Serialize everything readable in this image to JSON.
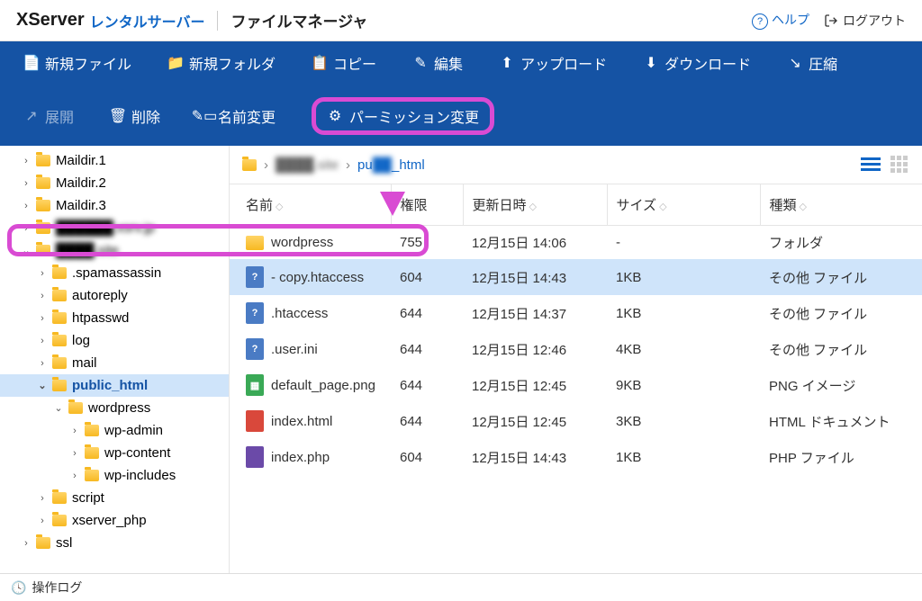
{
  "header": {
    "logo": "XServer",
    "logo_sub": "レンタルサーバー",
    "app_title": "ファイルマネージャ",
    "help": "ヘルプ",
    "logout": "ログアウト"
  },
  "toolbar": {
    "new_file": "新規ファイル",
    "new_folder": "新規フォルダ",
    "copy": "コピー",
    "edit": "編集",
    "upload": "アップロード",
    "download": "ダウンロード",
    "compress": "圧縮",
    "expand": "展開",
    "delete": "削除",
    "rename": "名前変更",
    "permission": "パーミッション変更"
  },
  "tree": [
    {
      "indent": 1,
      "chev": ">",
      "label": "Maildir.1"
    },
    {
      "indent": 1,
      "chev": ">",
      "label": "Maildir.2"
    },
    {
      "indent": 1,
      "chev": ">",
      "label": "Maildir.3"
    },
    {
      "indent": 1,
      "chev": ">",
      "label": "██████.xsrv.jp",
      "blur": true
    },
    {
      "indent": 1,
      "chev": "v",
      "label": "████.site",
      "blur": true
    },
    {
      "indent": 2,
      "chev": ">",
      "label": ".spamassassin"
    },
    {
      "indent": 2,
      "chev": ">",
      "label": "autoreply"
    },
    {
      "indent": 2,
      "chev": ">",
      "label": "htpasswd"
    },
    {
      "indent": 2,
      "chev": ">",
      "label": "log"
    },
    {
      "indent": 2,
      "chev": ">",
      "label": "mail"
    },
    {
      "indent": 2,
      "chev": "v",
      "label": "public_html",
      "selected": true
    },
    {
      "indent": 3,
      "chev": "v",
      "label": "wordpress"
    },
    {
      "indent": 4,
      "chev": ">",
      "label": "wp-admin"
    },
    {
      "indent": 4,
      "chev": ">",
      "label": "wp-content"
    },
    {
      "indent": 4,
      "chev": ">",
      "label": "wp-includes"
    },
    {
      "indent": 2,
      "chev": ">",
      "label": "script"
    },
    {
      "indent": 2,
      "chev": ">",
      "label": "xserver_php"
    },
    {
      "indent": 1,
      "chev": ">",
      "label": "ssl"
    }
  ],
  "breadcrumb": {
    "seg1_blur": "████.site",
    "seg2_a": "pu",
    "seg2_b": "_html"
  },
  "columns": {
    "name": "名前",
    "perm": "権限",
    "date": "更新日時",
    "size": "サイズ",
    "type": "種類"
  },
  "files": [
    {
      "icon": "folder",
      "name": "wordpress",
      "perm": "755",
      "date": "12月15日 14:06",
      "size": "-",
      "type": "フォルダ"
    },
    {
      "icon": "unknown",
      "name": "- copy.htaccess",
      "perm": "604",
      "date": "12月15日 14:43",
      "size": "1KB",
      "type": "その他 ファイル",
      "selected": true
    },
    {
      "icon": "unknown",
      "name": ".htaccess",
      "perm": "644",
      "date": "12月15日 14:37",
      "size": "1KB",
      "type": "その他 ファイル"
    },
    {
      "icon": "unknown",
      "name": ".user.ini",
      "perm": "644",
      "date": "12月15日 12:46",
      "size": "4KB",
      "type": "その他 ファイル"
    },
    {
      "icon": "image",
      "name": "default_page.png",
      "perm": "644",
      "date": "12月15日 12:45",
      "size": "9KB",
      "type": "PNG イメージ"
    },
    {
      "icon": "html",
      "name": "index.html",
      "perm": "644",
      "date": "12月15日 12:45",
      "size": "3KB",
      "type": "HTML ドキュメント"
    },
    {
      "icon": "php",
      "name": "index.php",
      "perm": "604",
      "date": "12月15日 14:43",
      "size": "1KB",
      "type": "PHP ファイル"
    }
  ],
  "footer": {
    "log": "操作ログ"
  }
}
